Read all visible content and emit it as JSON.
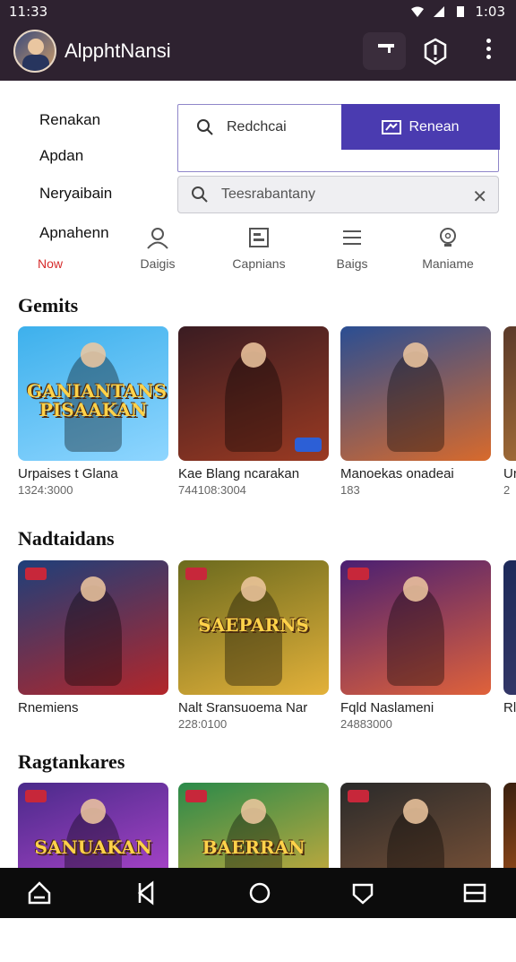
{
  "status": {
    "time": "11:33",
    "clock_right": "1:03"
  },
  "app": {
    "title": "AlpphtNansi"
  },
  "filters": {
    "items": [
      "Renakan",
      "Apdan",
      "Neryaibain",
      "Apnahenn"
    ]
  },
  "segmented": {
    "left_label": "Redchcai",
    "right_label": "Renean"
  },
  "search": {
    "placeholder": "Teesrabantany",
    "value": "Teesrabantany",
    "clear_label": "✕"
  },
  "tabs": [
    {
      "label": "Now",
      "icon": "none",
      "active": true
    },
    {
      "label": "Daigis",
      "icon": "person-icon"
    },
    {
      "label": "Capnians",
      "icon": "card-icon"
    },
    {
      "label": "Baigs",
      "icon": "list-icon"
    },
    {
      "label": "Maniame",
      "icon": "bulb-icon"
    }
  ],
  "sections": [
    {
      "title": "Gemits",
      "items": [
        {
          "name": "Urpaises t Glana",
          "count": "1324:3000",
          "logo": "GANIANTANS PISAAKAN",
          "colors": [
            "#3db0ec",
            "#8fd6ff"
          ]
        },
        {
          "name": "Kae Blang ncarakan",
          "count": "744108:3004",
          "logo": "",
          "colors": [
            "#3a1c22",
            "#9b3a22"
          ]
        },
        {
          "name": "Manoekas onadeai",
          "count": "183",
          "logo": "",
          "colors": [
            "#2a4e93",
            "#d86a2c"
          ]
        },
        {
          "name": "Ur",
          "count": "2",
          "logo": "",
          "colors": [
            "#5b3a2a",
            "#b57a3a"
          ]
        }
      ]
    },
    {
      "title": "Nadtaidans",
      "items": [
        {
          "name": "Rnemiens",
          "count": "",
          "logo": "",
          "colors": [
            "#1e3f7a",
            "#b3262a"
          ]
        },
        {
          "name": "Nalt Sransuoema Nar",
          "count": "228:0100",
          "logo": "SAEPARNS",
          "colors": [
            "#6b6a1e",
            "#e3b13a"
          ]
        },
        {
          "name": "Fqld Naslameni",
          "count": "24883000",
          "logo": "",
          "colors": [
            "#4a1f72",
            "#e0623a"
          ]
        },
        {
          "name": "Rl",
          "count": "",
          "logo": "",
          "colors": [
            "#1d2a5a",
            "#3b3b6b"
          ]
        }
      ]
    },
    {
      "title": "Ragtankares",
      "items": [
        {
          "name": "",
          "count": "",
          "logo": "SANUAKAN",
          "colors": [
            "#4a2a8a",
            "#c04ad8"
          ]
        },
        {
          "name": "",
          "count": "",
          "logo": "BAERRAN",
          "colors": [
            "#2a8a4a",
            "#e8b13a"
          ]
        },
        {
          "name": "",
          "count": "",
          "logo": "",
          "colors": [
            "#2a2a2a",
            "#8a5a3a"
          ]
        },
        {
          "name": "",
          "count": "",
          "logo": "",
          "colors": [
            "#3a2010",
            "#d86a20"
          ]
        },
        {
          "name": "",
          "count": "",
          "logo": "",
          "colors": [
            "#1a2a6a",
            "#3a4aaa"
          ]
        }
      ]
    }
  ]
}
